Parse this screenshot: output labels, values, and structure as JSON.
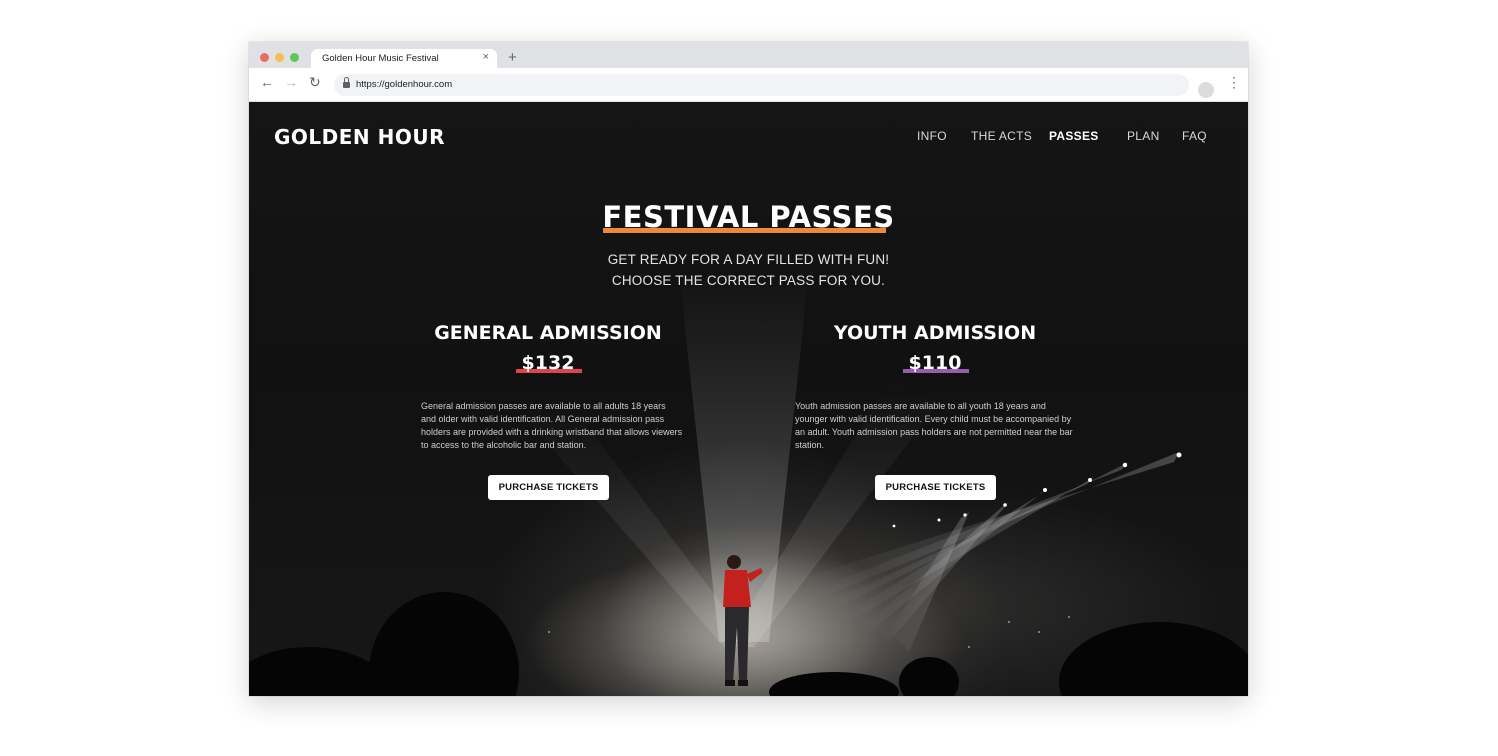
{
  "browser": {
    "tab_title": "Golden Hour Music Festival",
    "tab_close": "×",
    "new_tab": "+",
    "url": "https://goldenhour.com",
    "icons": [
      "back-arrow-icon",
      "forward-arrow-icon",
      "reload-icon",
      "lock-icon",
      "star-icon",
      "profile-icon",
      "menu-dots-icon"
    ]
  },
  "site": {
    "logo": "GOLDEN HOUR",
    "nav": [
      {
        "label": "INFO"
      },
      {
        "label": "THE ACTS"
      },
      {
        "label": "PASSES",
        "active": true
      },
      {
        "label": "PLAN"
      },
      {
        "label": "FAQ"
      }
    ],
    "title": "FESTIVAL PASSES",
    "subtitle_line1": "GET READY FOR A DAY FILLED WITH FUN!",
    "subtitle_line2": "CHOOSE THE CORRECT PASS FOR YOU.",
    "passes": [
      {
        "name": "GENERAL ADMISSION",
        "price": "$132",
        "underline_color": "#e0434a",
        "description": "General admission passes are available to all adults 18 years and older with valid identification. All General admission pass holders are provided with a drinking wristband that allows viewers to access to the alcoholic bar and station.",
        "button": "PURCHASE TICKETS"
      },
      {
        "name": "YOUTH ADMISSION",
        "price": "$110",
        "underline_color": "#9b59b6",
        "description": "Youth admission passes are available to all youth 18 years and younger with valid identification. Every child must be accompanied by an adult. Youth admission pass holders are not permitted near the bar station.",
        "button": "PURCHASE TICKETS"
      }
    ],
    "colors": {
      "title_underline": "#f0883a",
      "background": "#111111"
    }
  }
}
